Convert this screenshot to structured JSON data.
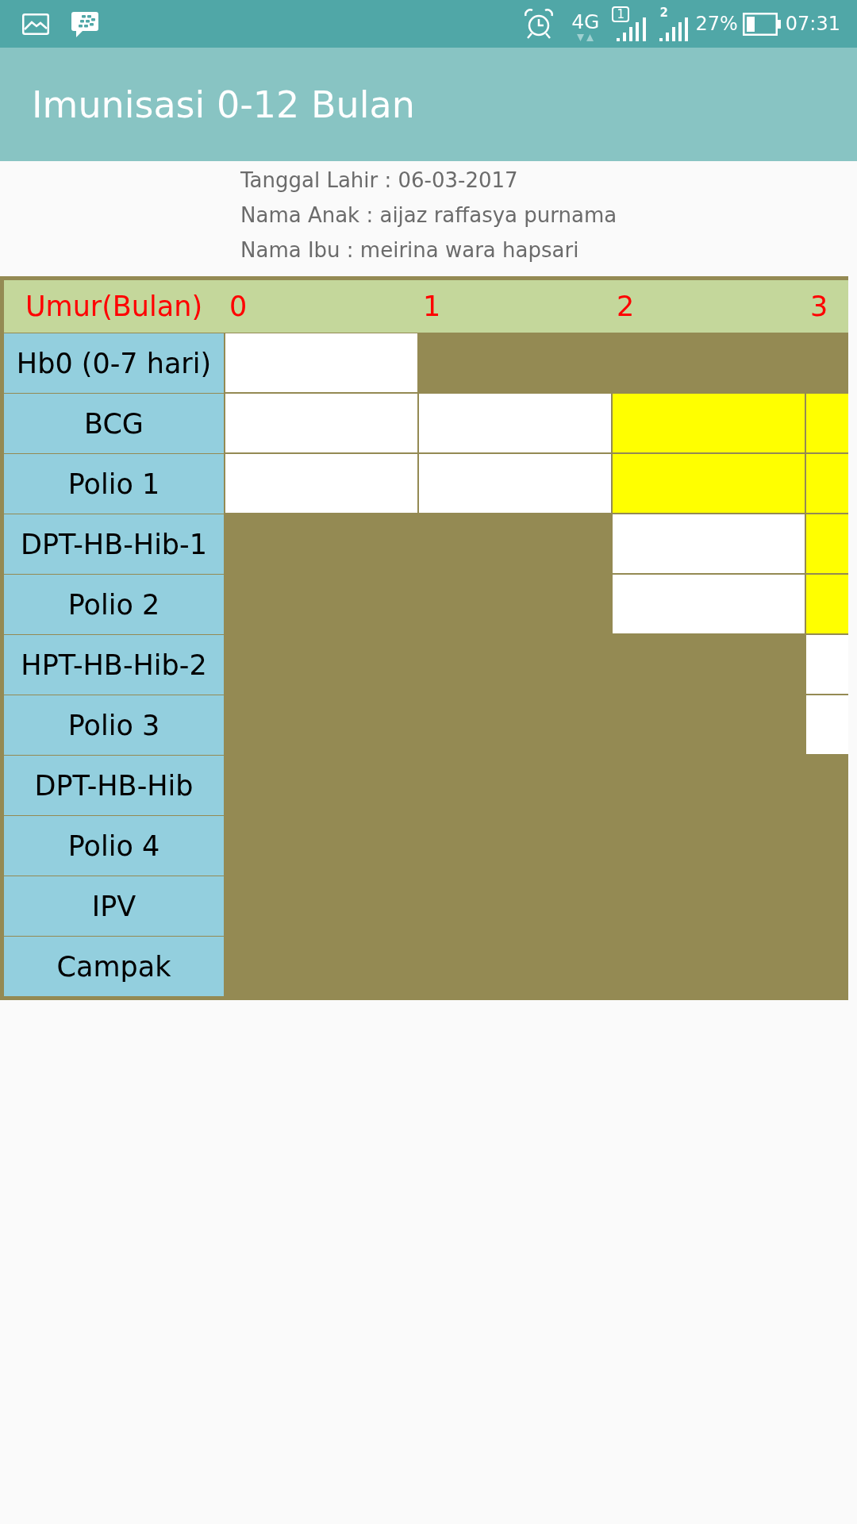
{
  "status_bar": {
    "network": "4G",
    "sim_1": "1",
    "sim_2": "2",
    "battery": "27%",
    "time": "07:31"
  },
  "app_bar": {
    "title": "Imunisasi 0-12 Bulan"
  },
  "info": [
    "Tanggal Lahir : 06-03-2017",
    "Nama Anak : aijaz raffasya purnama",
    "Nama Ibu : meirina wara hapsari"
  ],
  "table": {
    "header_label": "Umur(Bulan)",
    "months": [
      "0",
      "1",
      "2",
      "3"
    ],
    "rows": [
      {
        "vaccine": "Hb0 (0-7 hari)",
        "cells": [
          {
            "kind": "box",
            "color": "#ffffff"
          },
          {
            "kind": "none"
          },
          {
            "kind": "none"
          },
          {
            "kind": "none"
          }
        ]
      },
      {
        "vaccine": "BCG",
        "cells": [
          {
            "kind": "box",
            "color": "#ffffff"
          },
          {
            "kind": "box",
            "color": "#ffffff"
          },
          {
            "kind": "box",
            "color": "#ffff00"
          },
          {
            "kind": "box",
            "color": "#ffff00"
          }
        ]
      },
      {
        "vaccine": "Polio 1",
        "cells": [
          {
            "kind": "box",
            "color": "#ffffff"
          },
          {
            "kind": "box",
            "color": "#ffffff"
          },
          {
            "kind": "box",
            "color": "#ffff00"
          },
          {
            "kind": "box",
            "color": "#ffff00"
          }
        ]
      },
      {
        "vaccine": "DPT-HB-Hib-1",
        "cells": [
          {
            "kind": "none"
          },
          {
            "kind": "none"
          },
          {
            "kind": "box",
            "color": "#ffffff"
          },
          {
            "kind": "box",
            "color": "#ffff00"
          }
        ]
      },
      {
        "vaccine": "Polio 2",
        "cells": [
          {
            "kind": "none"
          },
          {
            "kind": "none"
          },
          {
            "kind": "box",
            "color": "#ffffff"
          },
          {
            "kind": "box",
            "color": "#ffff00"
          }
        ]
      },
      {
        "vaccine": "HPT-HB-Hib-2",
        "cells": [
          {
            "kind": "none"
          },
          {
            "kind": "none"
          },
          {
            "kind": "none"
          },
          {
            "kind": "box",
            "color": "#ffffff"
          }
        ]
      },
      {
        "vaccine": "Polio 3",
        "cells": [
          {
            "kind": "none"
          },
          {
            "kind": "none"
          },
          {
            "kind": "none"
          },
          {
            "kind": "box",
            "color": "#ffffff"
          }
        ]
      },
      {
        "vaccine": "DPT-HB-Hib",
        "cells": [
          {
            "kind": "none"
          },
          {
            "kind": "none"
          },
          {
            "kind": "none"
          },
          {
            "kind": "none"
          }
        ]
      },
      {
        "vaccine": "Polio 4",
        "cells": [
          {
            "kind": "none"
          },
          {
            "kind": "none"
          },
          {
            "kind": "none"
          },
          {
            "kind": "none"
          }
        ]
      },
      {
        "vaccine": "IPV",
        "cells": [
          {
            "kind": "none"
          },
          {
            "kind": "none"
          },
          {
            "kind": "none"
          },
          {
            "kind": "none"
          }
        ]
      },
      {
        "vaccine": "Campak",
        "cells": [
          {
            "kind": "none"
          },
          {
            "kind": "none"
          },
          {
            "kind": "none"
          },
          {
            "kind": "none"
          }
        ]
      }
    ]
  }
}
